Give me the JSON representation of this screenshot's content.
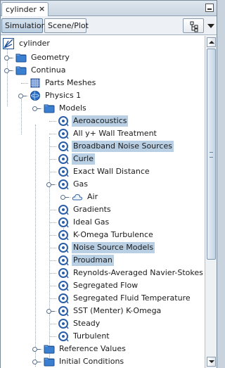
{
  "window": {
    "doc_tab_label": "cylinder",
    "close_glyph": "×"
  },
  "toolbar": {
    "tabs": [
      {
        "label": "Simulation",
        "active": true
      },
      {
        "label": "Scene/Plot",
        "active": false
      }
    ]
  },
  "tree": {
    "root": {
      "label": "cylinder",
      "icon": "simulation-icon"
    },
    "nodes": [
      {
        "label": "Geometry",
        "icon": "folder-icon",
        "depth": 1,
        "expandable": true,
        "selected": false
      },
      {
        "label": "Continua",
        "icon": "folder-icon",
        "depth": 1,
        "expandable": true,
        "selected": false
      },
      {
        "label": "Parts Meshes",
        "icon": "mesh-grid-icon",
        "depth": 2,
        "expandable": false,
        "selected": false
      },
      {
        "label": "Physics 1",
        "icon": "physics-sphere-icon",
        "depth": 2,
        "expandable": true,
        "selected": false
      },
      {
        "label": "Models",
        "icon": "folder-icon",
        "depth": 3,
        "expandable": true,
        "selected": false
      },
      {
        "label": "Aeroacoustics",
        "icon": "model-icon",
        "depth": 4,
        "expandable": false,
        "selected": true
      },
      {
        "label": "All y+ Wall Treatment",
        "icon": "model-icon",
        "depth": 4,
        "expandable": false,
        "selected": false
      },
      {
        "label": "Broadband Noise Sources",
        "icon": "model-icon",
        "depth": 4,
        "expandable": false,
        "selected": true
      },
      {
        "label": "Curle",
        "icon": "model-icon",
        "depth": 4,
        "expandable": false,
        "selected": true
      },
      {
        "label": "Exact Wall Distance",
        "icon": "model-icon",
        "depth": 4,
        "expandable": false,
        "selected": false
      },
      {
        "label": "Gas",
        "icon": "model-icon",
        "depth": 4,
        "expandable": true,
        "selected": false
      },
      {
        "label": "Air",
        "icon": "cloud-icon",
        "depth": 5,
        "expandable": true,
        "selected": false
      },
      {
        "label": "Gradients",
        "icon": "model-icon",
        "depth": 4,
        "expandable": false,
        "selected": false
      },
      {
        "label": "Ideal Gas",
        "icon": "model-icon",
        "depth": 4,
        "expandable": false,
        "selected": false
      },
      {
        "label": "K-Omega Turbulence",
        "icon": "model-icon",
        "depth": 4,
        "expandable": false,
        "selected": false
      },
      {
        "label": "Noise Source Models",
        "icon": "model-icon",
        "depth": 4,
        "expandable": false,
        "selected": true
      },
      {
        "label": "Proudman",
        "icon": "model-icon",
        "depth": 4,
        "expandable": false,
        "selected": true
      },
      {
        "label": "Reynolds-Averaged Navier-Stokes",
        "icon": "model-icon",
        "depth": 4,
        "expandable": false,
        "selected": false
      },
      {
        "label": "Segregated Flow",
        "icon": "model-icon",
        "depth": 4,
        "expandable": false,
        "selected": false
      },
      {
        "label": "Segregated Fluid Temperature",
        "icon": "model-icon",
        "depth": 4,
        "expandable": false,
        "selected": false
      },
      {
        "label": "SST (Menter) K-Omega",
        "icon": "model-icon",
        "depth": 4,
        "expandable": true,
        "selected": false
      },
      {
        "label": "Steady",
        "icon": "model-icon",
        "depth": 4,
        "expandable": false,
        "selected": false
      },
      {
        "label": "Turbulent",
        "icon": "model-icon",
        "depth": 4,
        "expandable": false,
        "selected": false
      },
      {
        "label": "Reference Values",
        "icon": "folder-icon",
        "depth": 3,
        "expandable": true,
        "selected": false
      },
      {
        "label": "Initial Conditions",
        "icon": "folder-icon",
        "depth": 3,
        "expandable": true,
        "selected": false
      }
    ]
  },
  "colors": {
    "selection": "#b8cfe4",
    "folder": "#2f6fbf",
    "model_ring": "#2c5fa8"
  }
}
